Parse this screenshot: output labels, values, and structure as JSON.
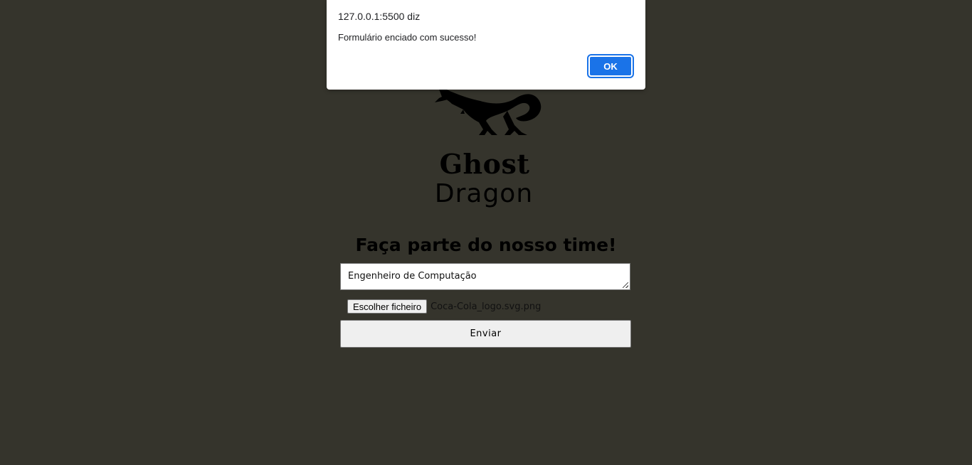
{
  "dialog": {
    "title": "127.0.0.1:5500 diz",
    "message": "Formulário enciado com sucesso!",
    "ok_label": "OK"
  },
  "logo": {
    "line1": "Ghost",
    "line2": "Dragon"
  },
  "form": {
    "heading": "Faça parte do nosso time!",
    "textarea_value": "Engenheiro de Computação",
    "file_button_label": "Escolher ficheiro",
    "file_name": "Coca-Cola_logo.svg.png",
    "submit_label": "Enviar"
  },
  "colors": {
    "background": "#35342c",
    "accent": "#1a73e8"
  }
}
